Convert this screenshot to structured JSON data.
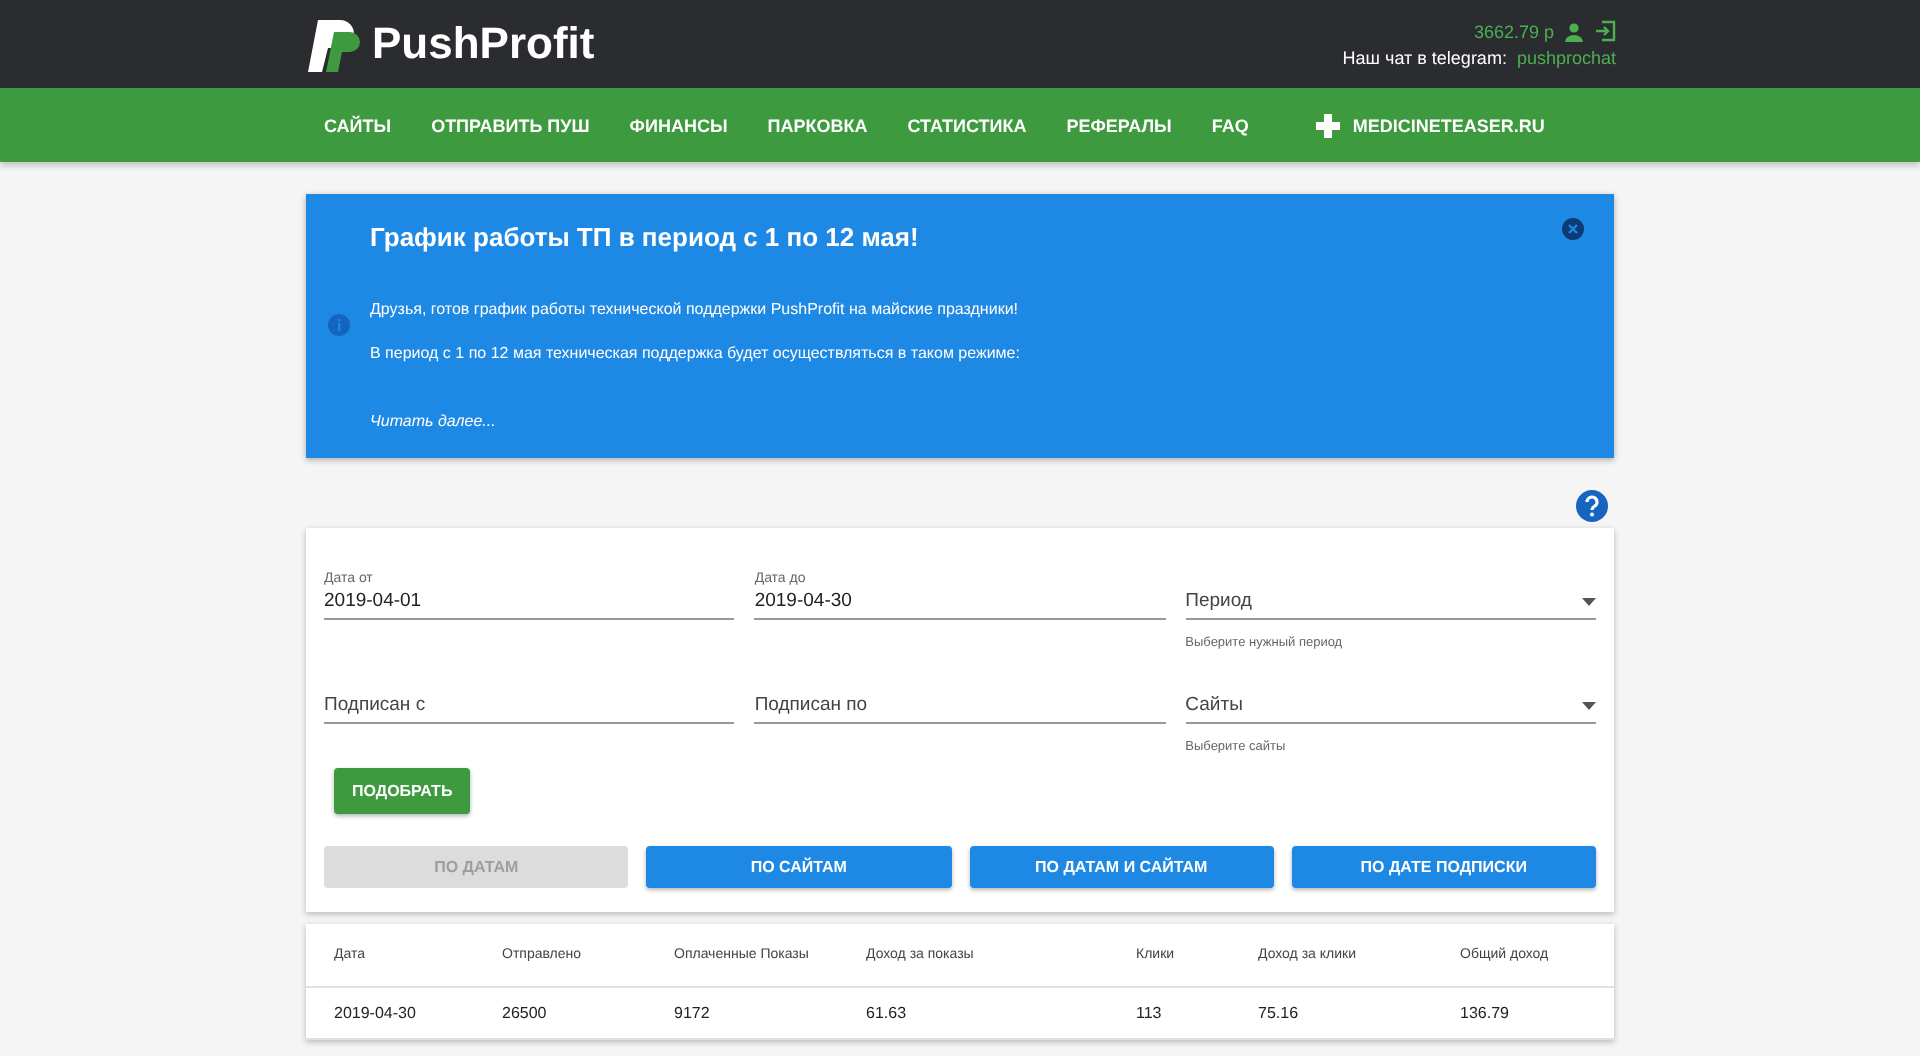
{
  "header": {
    "logo_text": "PushProfit",
    "balance": "3662.79 р",
    "chat_label": "Наш чат в telegram:",
    "chat_link": "pushprochat"
  },
  "nav": {
    "items": [
      {
        "label": "САЙТЫ",
        "kind": "link"
      },
      {
        "label": "ОТПРАВИТЬ ПУШ",
        "kind": "link"
      },
      {
        "label": "ФИНАНСЫ",
        "kind": "link"
      },
      {
        "label": "ПАРКОВКА",
        "kind": "link"
      },
      {
        "label": "СТАТИСТИКА",
        "kind": "link"
      },
      {
        "label": "РЕФЕРАЛЫ",
        "kind": "link"
      },
      {
        "label": "FAQ",
        "kind": "link"
      },
      {
        "label": "MEDICINETEASER.RU",
        "kind": "brand"
      }
    ]
  },
  "notice": {
    "title": "График работы ТП в период с 1 по 12 мая!",
    "paragraphs": [
      "Друзья, готов график работы технической поддержки PushProfit на майские праздники!",
      "В период с 1 по 12 мая техническая поддержка будет осуществляться в таком режиме:"
    ],
    "read_more": "Читать далее..."
  },
  "filters": {
    "fields": [
      {
        "kind": "text",
        "label": "Дата от",
        "value": "2019-04-01"
      },
      {
        "kind": "text",
        "label": "Дата до",
        "value": "2019-04-30"
      },
      {
        "kind": "select",
        "placeholder": "Период",
        "hint": "Выберите нужный период"
      },
      {
        "kind": "text",
        "placeholder": "Подписан с"
      },
      {
        "kind": "text",
        "placeholder": "Подписан по"
      },
      {
        "kind": "select",
        "placeholder": "Сайты",
        "hint": "Выберите сайты"
      }
    ],
    "submit": "ПОДОБРАТЬ",
    "group_by": [
      {
        "label": "ПО ДАТАМ",
        "selected": true
      },
      {
        "label": "ПО САЙТАМ",
        "selected": false
      },
      {
        "label": "ПО ДАТАМ И САЙТАМ",
        "selected": false
      },
      {
        "label": "ПО ДАТЕ ПОДПИСКИ",
        "selected": false
      }
    ]
  },
  "table": {
    "columns": [
      "Дата",
      "Отправлено",
      "Оплаченные Показы",
      "Доход за показы",
      "Клики",
      "Доход за клики",
      "Общий доход"
    ],
    "rows": [
      [
        "2019-04-30",
        "26500",
        "9172",
        "61.63",
        "113",
        "75.16",
        "136.79"
      ]
    ]
  }
}
